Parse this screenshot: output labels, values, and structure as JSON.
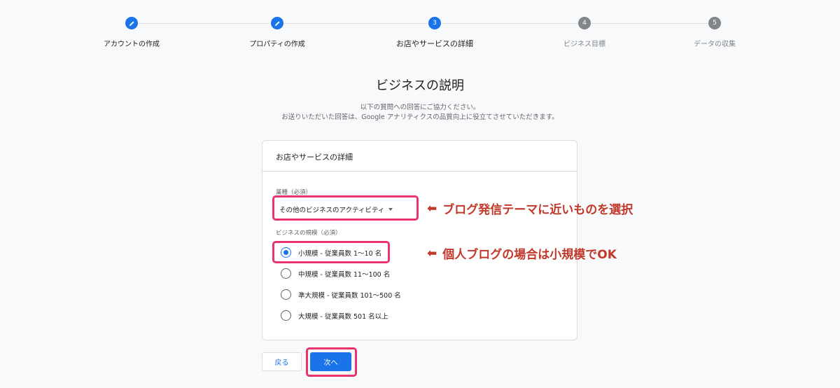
{
  "stepper": {
    "steps": [
      {
        "number": "",
        "label": "アカウントの作成",
        "state": "done",
        "icon": "pencil-icon"
      },
      {
        "number": "",
        "label": "プロパティの作成",
        "state": "done",
        "icon": "pencil-icon"
      },
      {
        "number": "3",
        "label": "お店やサービスの詳細",
        "state": "active"
      },
      {
        "number": "4",
        "label": "ビジネス目標",
        "state": "pending"
      },
      {
        "number": "5",
        "label": "データの収集",
        "state": "pending"
      }
    ]
  },
  "page": {
    "title": "ビジネスの説明",
    "desc_line1": "以下の質問への回答にご協力ください。",
    "desc_line2": "お送りいただいた回答は、Google アナリティクスの品質向上に役立てさせていただきます。"
  },
  "card": {
    "header": "お店やサービスの詳細",
    "industry_label": "業種（必須）",
    "industry_value": "その他のビジネスのアクティビティ",
    "size_label": "ビジネスの規模（必須）",
    "size_options": [
      {
        "label": "小規模 - 従業員数 1～10 名",
        "checked": true
      },
      {
        "label": "中規模 - 従業員数 11～100 名",
        "checked": false
      },
      {
        "label": "準大規模 - 従業員数 101～500 名",
        "checked": false
      },
      {
        "label": "大規模 - 従業員数 501 名以上",
        "checked": false
      }
    ]
  },
  "annotations": {
    "note1": "ブログ発信テーマに近いものを選択",
    "note2": "個人ブログの場合は小規模でOK",
    "arrow": "⬅"
  },
  "buttons": {
    "back": "戻る",
    "next": "次へ"
  },
  "colors": {
    "primary": "#1a73e8",
    "highlight": "#e8336d",
    "annotation": "#c0392b"
  }
}
